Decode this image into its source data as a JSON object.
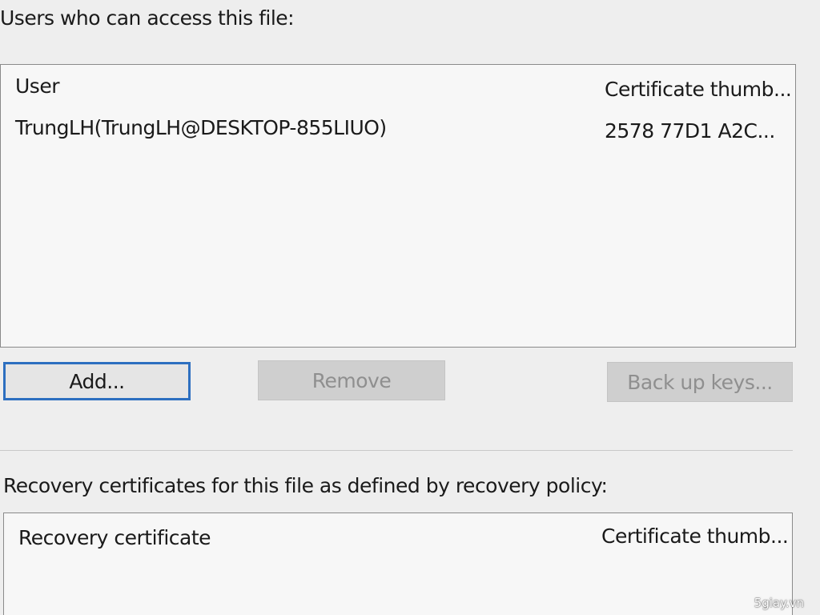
{
  "users_section": {
    "label": "Users who can access this file:",
    "columns": [
      "User",
      "Certificate thumb..."
    ],
    "rows": [
      {
        "user": "TrungLH(TrungLH@DESKTOP-855LIUO)",
        "thumbprint": "2578 77D1 A2C..."
      }
    ]
  },
  "buttons": {
    "add": "Add...",
    "remove": "Remove",
    "backup": "Back up keys..."
  },
  "recovery_section": {
    "label": "Recovery certificates for this file as defined by recovery policy:",
    "columns": [
      "Recovery certificate",
      "Certificate thumb..."
    ]
  },
  "watermark": "5giay.vn",
  "colors": {
    "focus_border": "#2d6fc0",
    "disabled_text": "#8f8f8f"
  }
}
